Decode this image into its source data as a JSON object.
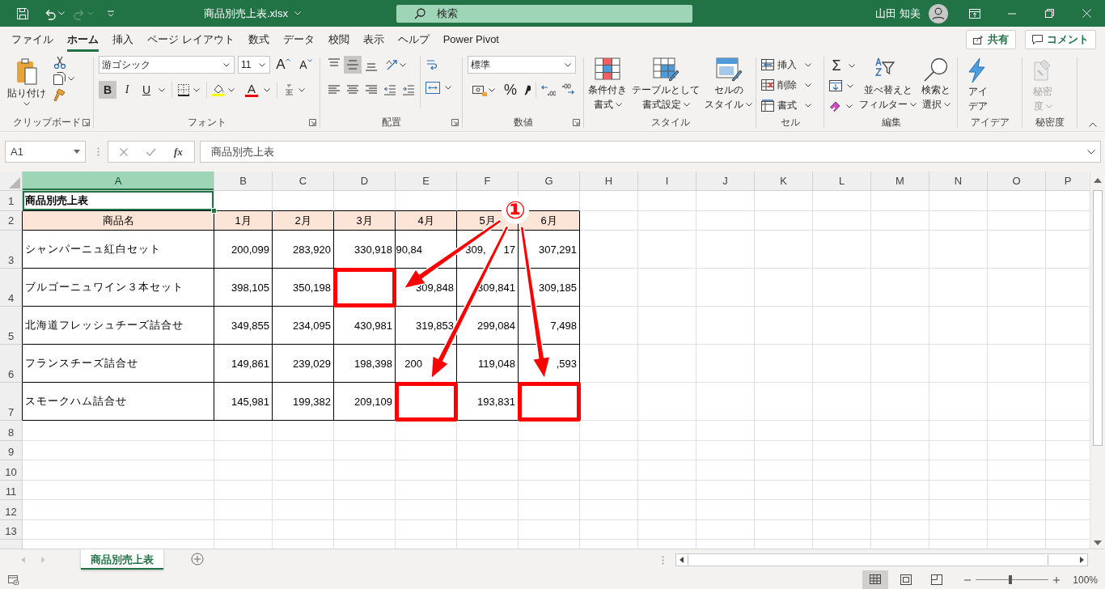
{
  "title_bar": {
    "file_name": "商品別売上表.xlsx",
    "search_placeholder": "検索",
    "user_name": "山田 知美"
  },
  "menu_tabs": [
    {
      "label": "ファイル",
      "selected": false
    },
    {
      "label": "ホーム",
      "selected": true
    },
    {
      "label": "挿入",
      "selected": false
    },
    {
      "label": "ページ レイアウト",
      "selected": false
    },
    {
      "label": "数式",
      "selected": false
    },
    {
      "label": "データ",
      "selected": false
    },
    {
      "label": "校閲",
      "selected": false
    },
    {
      "label": "表示",
      "selected": false
    },
    {
      "label": "ヘルプ",
      "selected": false
    },
    {
      "label": "Power Pivot",
      "selected": false
    }
  ],
  "share_button": "共有",
  "comment_button": "コメント",
  "ribbon": {
    "groups": [
      {
        "kind": "clipboard",
        "label": "クリップボード",
        "paste": "貼り付け"
      },
      {
        "kind": "font",
        "label": "フォント",
        "font_name": "游ゴシック",
        "font_size": "11",
        "grow": "A",
        "shrink": "A",
        "styles": [
          {
            "text": "B",
            "selected": true
          },
          {
            "text": "I",
            "selected": false
          },
          {
            "text": "U",
            "selected": false
          }
        ],
        "font_color": "A"
      },
      {
        "kind": "alignment",
        "label": "配置",
        "vertical": [
          {
            "selected": false
          },
          {
            "selected": true
          },
          {
            "selected": false
          }
        ]
      },
      {
        "kind": "number",
        "label": "数値",
        "format": "標準",
        "percent": "%"
      },
      {
        "kind": "styles",
        "label": "スタイル",
        "buttons": [
          {
            "lines": [
              "条件付き",
              "書式"
            ]
          },
          {
            "lines": [
              "テーブルとして",
              "書式設定"
            ]
          },
          {
            "lines": [
              "セルの",
              "スタイル"
            ]
          }
        ]
      },
      {
        "kind": "cells",
        "label": "セル",
        "buttons": [
          "挿入",
          "削除",
          "書式"
        ]
      },
      {
        "kind": "editing",
        "label": "編集",
        "sum": "Σ",
        "buttons": [
          {
            "lines": [
              "並べ替えと",
              "フィルター"
            ]
          },
          {
            "lines": [
              "検索と",
              "選択"
            ]
          }
        ]
      },
      {
        "kind": "ideas",
        "label": "アイデア",
        "lines": [
          "アイ",
          "デア"
        ]
      },
      {
        "kind": "sensitivity",
        "label": "秘密度",
        "lines": [
          "秘密",
          "度"
        ],
        "disabled": true
      }
    ]
  },
  "formula_bar": {
    "name_box": "A1",
    "function_button": "fx",
    "formula": "商品別売上表"
  },
  "sheet": {
    "columns": [
      {
        "label": "A",
        "selected": true
      },
      {
        "label": "B",
        "selected": false
      },
      {
        "label": "C",
        "selected": false
      },
      {
        "label": "D",
        "selected": false
      },
      {
        "label": "E",
        "selected": false
      },
      {
        "label": "F",
        "selected": false
      },
      {
        "label": "G",
        "selected": false
      },
      {
        "label": "H",
        "selected": false
      },
      {
        "label": "I",
        "selected": false
      },
      {
        "label": "J",
        "selected": false
      },
      {
        "label": "K",
        "selected": false
      },
      {
        "label": "L",
        "selected": false
      },
      {
        "label": "M",
        "selected": false
      },
      {
        "label": "N",
        "selected": false
      },
      {
        "label": "O",
        "selected": false
      },
      {
        "label": "P",
        "selected": false
      }
    ],
    "rows": [
      "1",
      "2",
      "3",
      "4",
      "5",
      "6",
      "7",
      "8",
      "9",
      "10",
      "11",
      "12",
      "13"
    ],
    "title_cell": {
      "text": "商品別売上表",
      "selected": true
    },
    "table": {
      "headers": [
        "商品名",
        "1月",
        "2月",
        "3月",
        "4月",
        "5月",
        "6月"
      ],
      "rows": [
        {
          "name": "シャンパーニュ紅白セット",
          "cells": [
            {
              "kind": "number",
              "text": "200,099",
              "highlighted": false
            },
            {
              "kind": "number",
              "text": "283,920",
              "highlighted": false
            },
            {
              "kind": "number",
              "text": "330,918",
              "highlighted": false
            },
            {
              "kind": "covered",
              "text": "90,84",
              "highlighted": false
            },
            {
              "kind": "split",
              "parts": [
                "309,",
                "17"
              ],
              "highlighted": false
            },
            {
              "kind": "number",
              "text": "307,291",
              "highlighted": false
            }
          ]
        },
        {
          "name": "ブルゴーニュワイン３本セット",
          "cells": [
            {
              "kind": "number",
              "text": "398,105",
              "highlighted": false
            },
            {
              "kind": "number",
              "text": "350,198",
              "highlighted": false
            },
            {
              "kind": "empty",
              "highlighted": true
            },
            {
              "kind": "number",
              "text": "309,848",
              "highlighted": false
            },
            {
              "kind": "number",
              "text": "309,841",
              "highlighted": false
            },
            {
              "kind": "number",
              "text": "309,185",
              "highlighted": false
            }
          ]
        },
        {
          "name": "北海道フレッシュチーズ詰合せ",
          "cells": [
            {
              "kind": "number",
              "text": "349,855",
              "highlighted": false
            },
            {
              "kind": "number",
              "text": "234,095",
              "highlighted": false
            },
            {
              "kind": "number",
              "text": "430,981",
              "highlighted": false
            },
            {
              "kind": "number",
              "text": "319,853",
              "highlighted": false
            },
            {
              "kind": "number",
              "text": "299,084",
              "highlighted": false
            },
            {
              "kind": "number",
              "text": "7,498",
              "highlighted": false
            }
          ]
        },
        {
          "name": "フランスチーズ詰合せ",
          "cells": [
            {
              "kind": "number",
              "text": "149,861",
              "highlighted": false
            },
            {
              "kind": "number",
              "text": "239,029",
              "highlighted": false
            },
            {
              "kind": "number",
              "text": "198,398",
              "highlighted": false
            },
            {
              "kind": "covered",
              "text": "200",
              "highlighted": false
            },
            {
              "kind": "number",
              "text": "119,048",
              "highlighted": false
            },
            {
              "kind": "number",
              "text": ",593",
              "highlighted": false
            }
          ]
        },
        {
          "name": "スモークハム詰合せ",
          "cells": [
            {
              "kind": "number",
              "text": "145,981",
              "highlighted": false
            },
            {
              "kind": "number",
              "text": "199,382",
              "highlighted": false
            },
            {
              "kind": "number",
              "text": "209,109",
              "highlighted": false
            },
            {
              "kind": "empty",
              "highlighted": true
            },
            {
              "kind": "number",
              "text": "193,831",
              "highlighted": false
            },
            {
              "kind": "empty",
              "highlighted": true
            }
          ]
        }
      ]
    },
    "annotation": {
      "marker": "①"
    }
  },
  "sheet_tabs": [
    {
      "label": "商品別売上表",
      "selected": true
    }
  ],
  "status_bar": {
    "view_buttons": [
      {
        "selected": true
      },
      {
        "selected": false
      },
      {
        "selected": false
      }
    ],
    "zoom": {
      "level": 0.48,
      "text": "100%"
    }
  }
}
